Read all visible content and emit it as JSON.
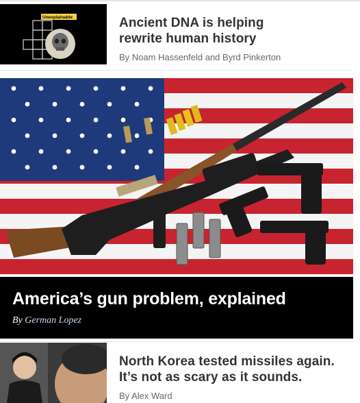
{
  "stories": [
    {
      "headline": "Ancient DNA is helping rewrite human history",
      "byline": "By Noam Hassenfeld and Byrd Pinkerton",
      "thumb_label": "Unexplainable"
    },
    {
      "headline": "America’s gun problem, explained",
      "byline_prefix": "By",
      "byline_author": "German Lopez"
    },
    {
      "headline": "North Korea tested missiles again. It’s not as scary as it sounds.",
      "byline": "By Alex Ward"
    }
  ],
  "icons": [
    "skull-icon"
  ],
  "colors": {
    "headline": "#333333",
    "byline": "#666666",
    "hero_band": "#000000",
    "hero_author": "#c9d8f0"
  }
}
